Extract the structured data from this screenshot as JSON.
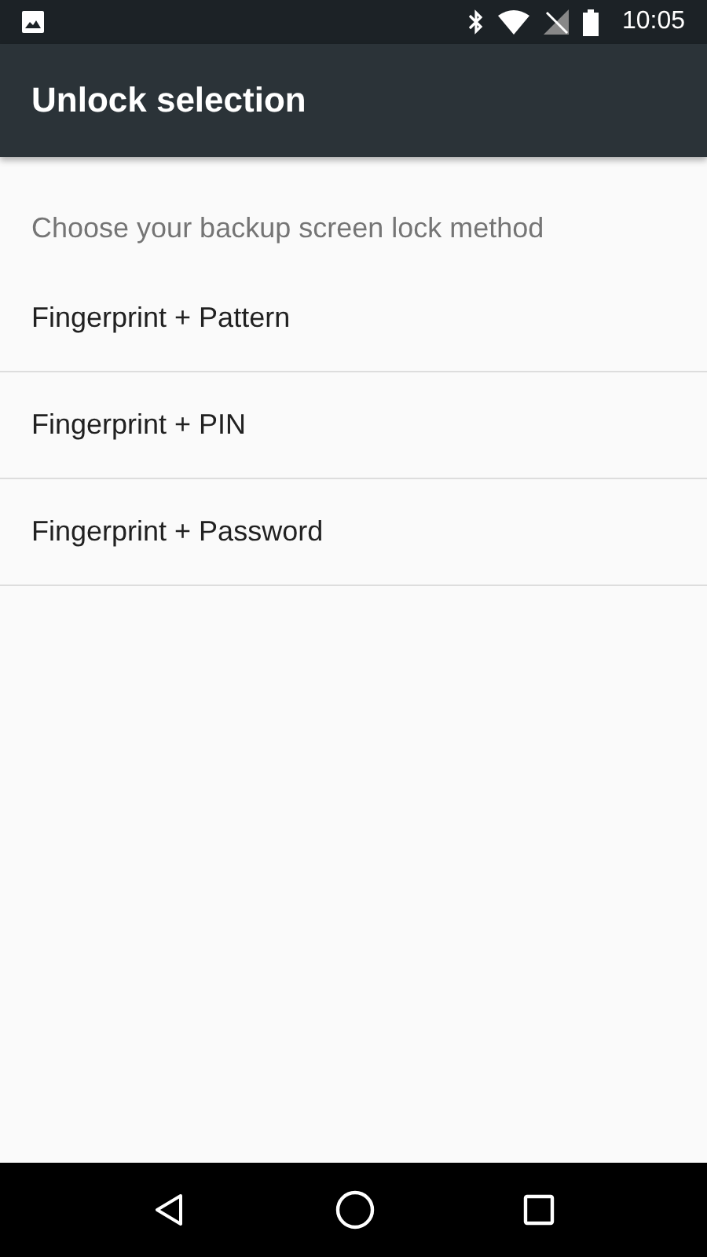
{
  "status_bar": {
    "time": "10:05"
  },
  "app_bar": {
    "title": "Unlock selection"
  },
  "subtitle": "Choose your backup screen lock method",
  "options": [
    {
      "label": "Fingerprint + Pattern"
    },
    {
      "label": "Fingerprint + PIN"
    },
    {
      "label": "Fingerprint + Password"
    }
  ]
}
